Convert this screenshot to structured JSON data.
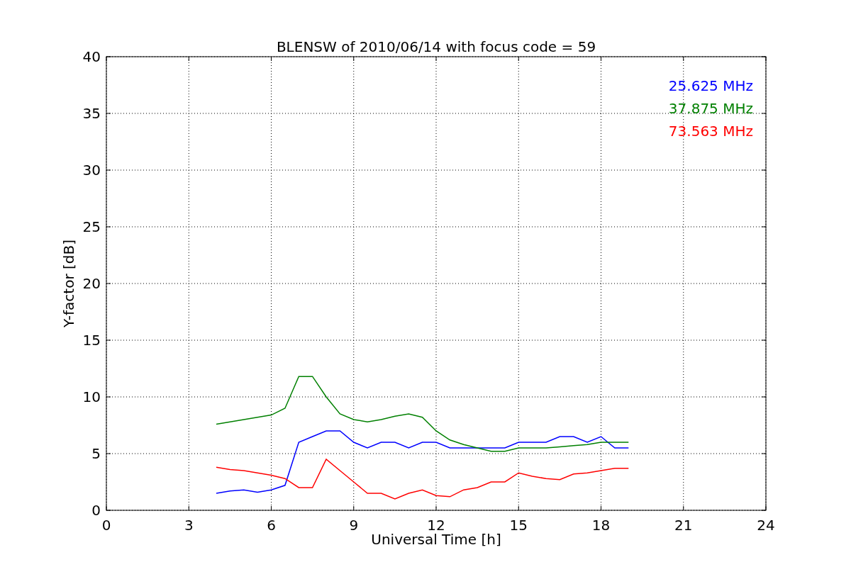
{
  "figure": {
    "chart_data": {
      "type": "line",
      "title": "BLENSW of 2010/06/14 with focus code = 59",
      "xlabel": "Universal Time [h]",
      "ylabel": "Y-factor [dB]",
      "x": [
        4,
        4.5,
        5,
        5.5,
        6,
        6.5,
        7,
        7.5,
        8,
        8.5,
        9,
        9.5,
        10,
        10.5,
        11,
        11.5,
        12,
        12.5,
        13,
        13.5,
        14,
        14.5,
        15,
        15.5,
        16,
        16.5,
        17,
        17.5,
        18,
        18.5,
        19
      ],
      "grid": true,
      "xlim": [
        0,
        24
      ],
      "ylim": [
        0,
        40
      ],
      "xticks": [
        0,
        3,
        6,
        9,
        12,
        15,
        18,
        21,
        24
      ],
      "yticks": [
        0,
        5,
        10,
        15,
        20,
        25,
        30,
        35,
        40
      ],
      "series": [
        {
          "name": "25.625 MHz",
          "color": "#0000ff",
          "values": [
            1.5,
            1.7,
            1.8,
            1.6,
            1.8,
            2.2,
            6,
            6.5,
            7,
            7,
            6,
            5.5,
            6,
            6,
            5.5,
            6,
            6,
            5.5,
            5.5,
            5.5,
            5.5,
            5.5,
            6,
            6,
            6,
            6.5,
            6.5,
            6,
            6.5,
            5.5,
            5.5
          ]
        },
        {
          "name": "37.875 MHz",
          "color": "#008000",
          "values": [
            7.6,
            7.8,
            8,
            8.2,
            8.4,
            9,
            11.8,
            11.8,
            10,
            8.5,
            8,
            7.8,
            8,
            8.3,
            8.5,
            8.2,
            7,
            6.2,
            5.8,
            5.5,
            5.2,
            5.2,
            5.5,
            5.5,
            5.5,
            5.6,
            5.7,
            5.8,
            6,
            6,
            6
          ]
        },
        {
          "name": "73.563 MHz",
          "color": "#ff0000",
          "values": [
            3.8,
            3.6,
            3.5,
            3.3,
            3.1,
            2.8,
            2,
            2,
            4.5,
            3.5,
            2.5,
            1.5,
            1.5,
            1,
            1.5,
            1.8,
            1.3,
            1.2,
            1.8,
            2,
            2.5,
            2.5,
            3.3,
            3,
            2.8,
            2.7,
            3.2,
            3.3,
            3.5,
            3.7,
            3.7
          ]
        }
      ]
    }
  }
}
